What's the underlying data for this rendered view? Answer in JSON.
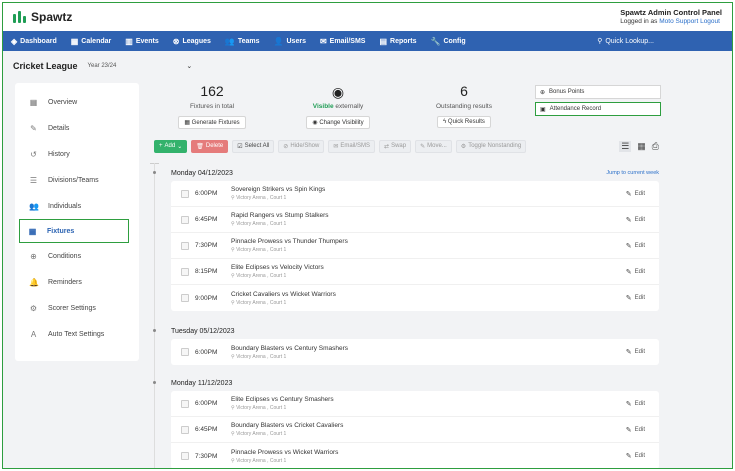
{
  "header": {
    "logo": "Spawtz",
    "panel_title": "Spawtz Admin Control Panel",
    "logged_in_prefix": "Logged in as",
    "user": "Moto Support",
    "logout": "Logout"
  },
  "nav": {
    "items": [
      "Dashboard",
      "Calendar",
      "Events",
      "Leagues",
      "Teams",
      "Users",
      "Email/SMS",
      "Reports",
      "Config"
    ],
    "quick_lookup": "Quick Lookup..."
  },
  "league": {
    "name": "Cricket League",
    "year": "Year 23/24"
  },
  "sidebar": {
    "items": [
      "Overview",
      "Details",
      "History",
      "Divisions/Teams",
      "Individuals",
      "Fixtures",
      "Conditions",
      "Reminders",
      "Scorer Settings",
      "Auto Text Settings"
    ]
  },
  "stats": {
    "fixtures_count": "162",
    "fixtures_label": "Fixtures in total",
    "generate_fixtures": "Generate Fixtures",
    "visible_word": "Visible",
    "visible_label": "externally",
    "change_visibility": "Change Visibility",
    "outstanding_count": "6",
    "outstanding_label": "Outstanding results",
    "quick_results": "Quick Results",
    "bonus_points": "Bonus Points",
    "attendance_record": "Attendance Record"
  },
  "toolbar": {
    "add": "Add",
    "delete": "Delete",
    "select_all": "Select All",
    "hide_show": "Hide/Show",
    "email_sms": "Email/SMS",
    "swap": "Swap",
    "move": "Move...",
    "toggle_nonstanding": "Toggle Nonstanding"
  },
  "jump_label": "Jump to current week",
  "edit_label": "Edit",
  "days": [
    {
      "date": "Monday 04/12/2023",
      "fixtures": [
        {
          "time": "6:00PM",
          "match": "Sovereign Strikers vs Spin Kings",
          "location": "Victory Arena , Court 1"
        },
        {
          "time": "6:45PM",
          "match": "Rapid Rangers vs Stump Stalkers",
          "location": "Victory Arena , Court 1"
        },
        {
          "time": "7:30PM",
          "match": "Pinnacle Prowess vs Thunder Thumpers",
          "location": "Victory Arena , Court 1"
        },
        {
          "time": "8:15PM",
          "match": "Elite Eclipses vs Velocity Victors",
          "location": "Victory Arena , Court 1"
        },
        {
          "time": "9:00PM",
          "match": "Cricket Cavaliers vs Wicket Warriors",
          "location": "Victory Arena , Court 1"
        }
      ]
    },
    {
      "date": "Tuesday 05/12/2023",
      "fixtures": [
        {
          "time": "6:00PM",
          "match": "Boundary Blasters vs Century Smashers",
          "location": "Victory Arena , Court 1"
        }
      ]
    },
    {
      "date": "Monday 11/12/2023",
      "fixtures": [
        {
          "time": "6:00PM",
          "match": "Elite Eclipses vs Century Smashers",
          "location": "Victory Arena , Court 1"
        },
        {
          "time": "6:45PM",
          "match": "Boundary Blasters vs Cricket Cavaliers",
          "location": "Victory Arena , Court 1"
        },
        {
          "time": "7:30PM",
          "match": "Pinnacle Prowess vs Wicket Warriors",
          "location": "Victory Arena , Court 1"
        }
      ]
    }
  ]
}
